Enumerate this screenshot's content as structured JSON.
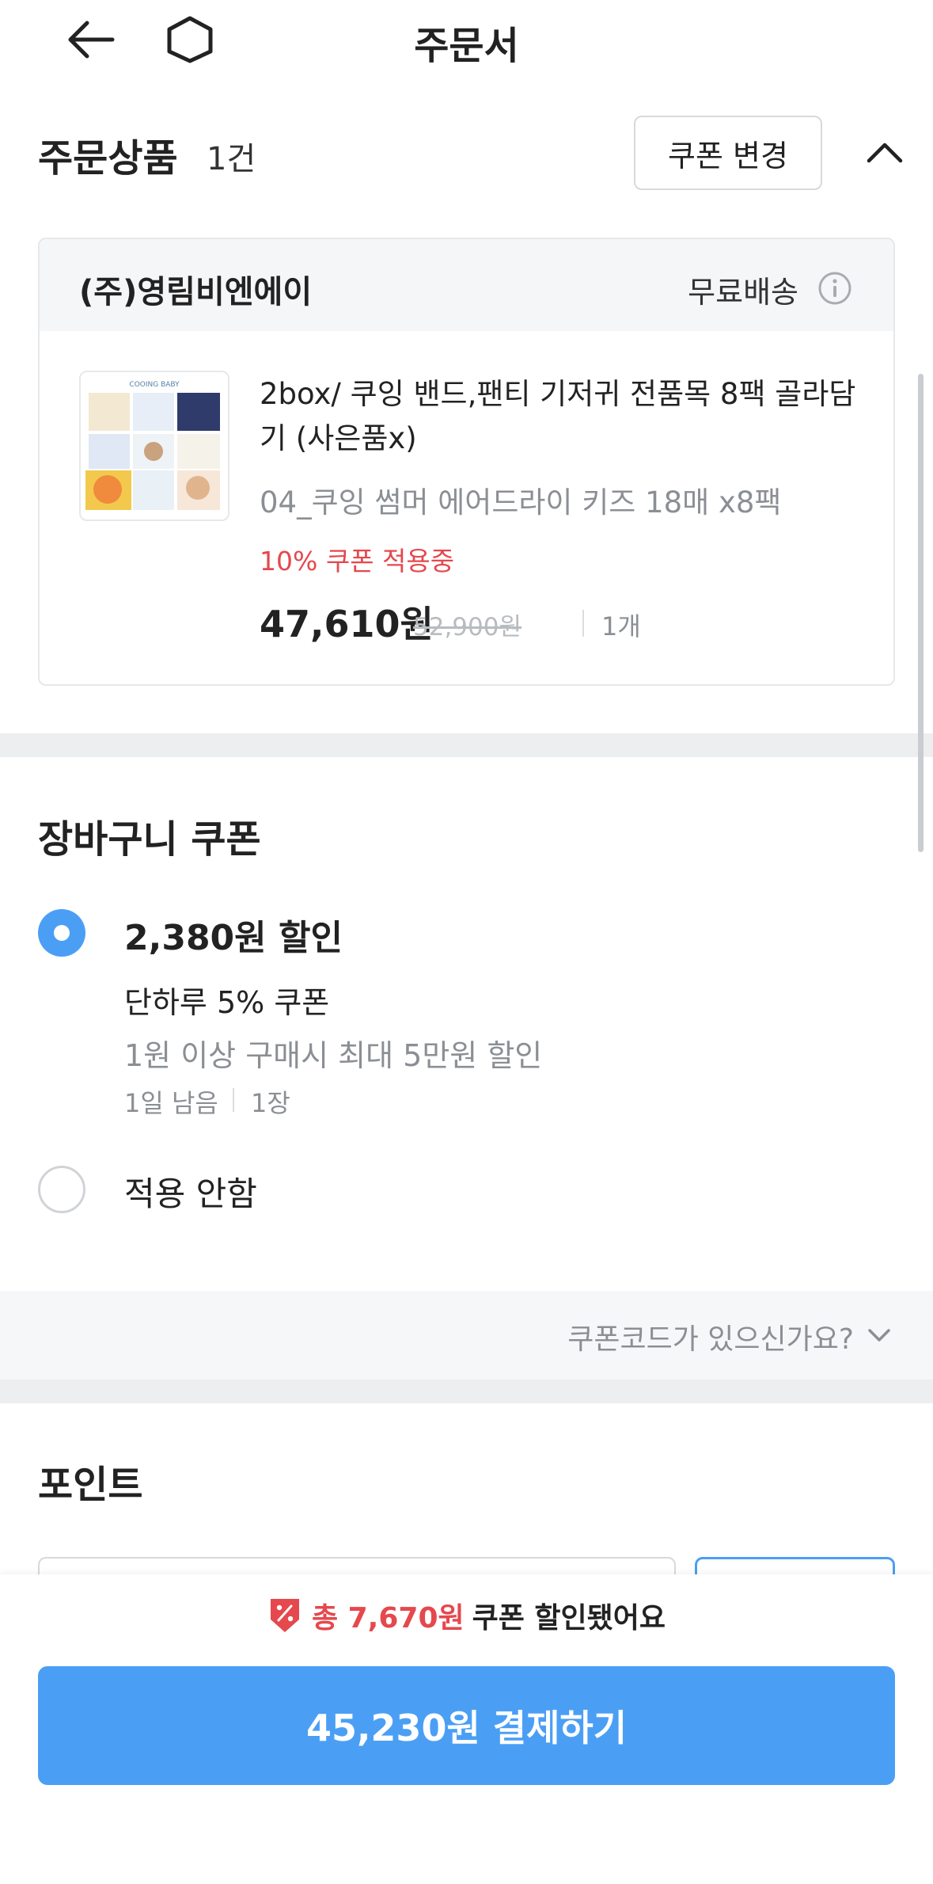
{
  "header": {
    "title": "주문서",
    "back_icon": "arrow-left-icon",
    "home_icon": "home-icon"
  },
  "order_products": {
    "title": "주문상품",
    "count": "1건",
    "coupon_change_label": "쿠폰 변경",
    "collapse_icon": "chevron-up-icon"
  },
  "product_card": {
    "seller": "(주)영림비엔에이",
    "shipping": "무료배송",
    "info_icon": "info-icon",
    "thumbnail_label": "COOING BABY",
    "name": "2box/ 쿠잉 밴드,팬티 기저귀 전품목 8팩 골라담기 (사은품x)",
    "option": "04_쿠잉 썸머 에어드라이 키즈 18매 x8팩",
    "coupon_status": "10% 쿠폰 적용중",
    "price": "47,610원",
    "original_price": "52,900원",
    "quantity": "1개"
  },
  "cart_coupon": {
    "title": "장바구니 쿠폰",
    "options": [
      {
        "selected": true,
        "amount": "2,380원 할인",
        "name": "단하루 5% 쿠폰",
        "condition": "1원 이상 구매시 최대 5만원 할인",
        "remaining": "1일 남음",
        "count": "1장"
      },
      {
        "selected": false,
        "label": "적용 안함"
      }
    ],
    "code_prompt": "쿠폰코드가 있으신가요?"
  },
  "points": {
    "title": "포인트"
  },
  "bottom_bar": {
    "saved_prefix": "총 7,670원",
    "saved_suffix": "쿠폰 할인됐어요",
    "pay_label": "45,230원 결제하기"
  },
  "colors": {
    "accent": "#4a9ff5",
    "discount_red": "#e5484d",
    "muted_text": "#8b8f94"
  }
}
